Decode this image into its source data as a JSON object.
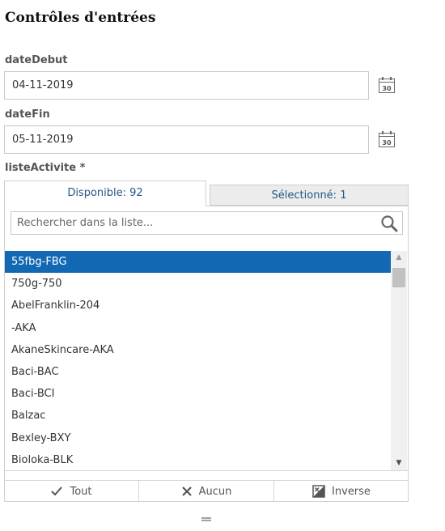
{
  "page": {
    "title": "Contrôles d'entrées"
  },
  "fields": {
    "date_debut": {
      "label": "dateDebut",
      "value": "04-11-2019",
      "icon": "calendar-icon",
      "icon_text": "30"
    },
    "date_fin": {
      "label": "dateFin",
      "value": "05-11-2019",
      "icon": "calendar-icon",
      "icon_text": "30"
    }
  },
  "liste_activite": {
    "label": "listeActivite *",
    "tabs": {
      "available": "Disponible: 92",
      "selected": "Sélectionné: 1"
    },
    "search": {
      "placeholder": "Rechercher dans la liste...",
      "icon": "search-icon"
    },
    "items": [
      "55fbg-FBG",
      "750g-750",
      "AbelFranklin-204",
      "-AKA",
      "AkaneSkincare-AKA",
      "Baci-BAC",
      "Baci-BCI",
      "Balzac",
      "Bexley-BXY",
      "Bioloka-BLK"
    ],
    "selected_index": 0,
    "actions": {
      "all": "Tout",
      "none": "Aucun",
      "inverse": "Inverse"
    }
  },
  "colors": {
    "selection": "#1268b3",
    "tab_text": "#245785"
  }
}
